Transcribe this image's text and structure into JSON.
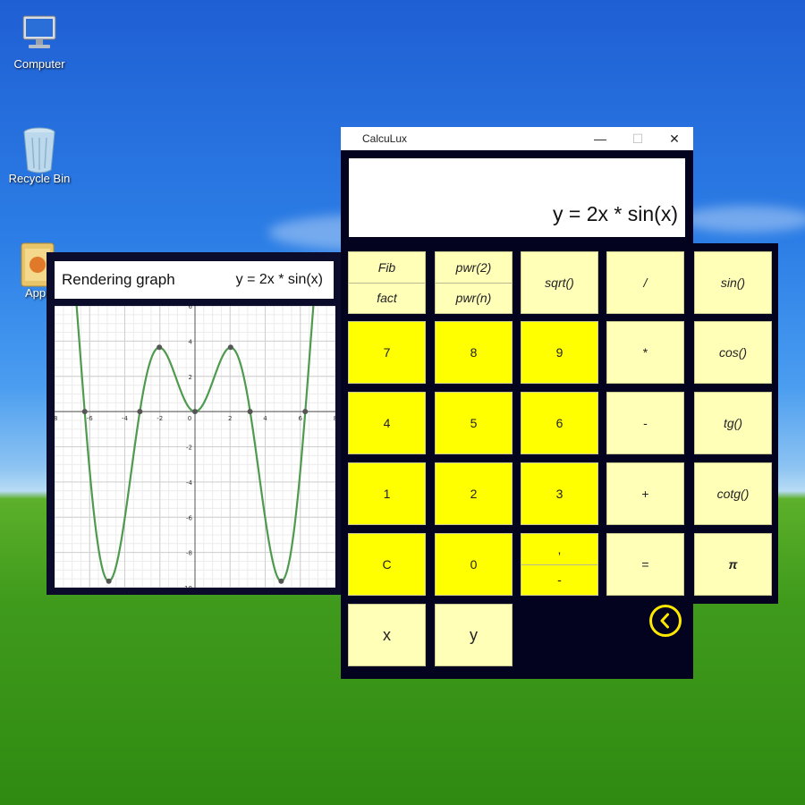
{
  "desktop": {
    "icons": [
      {
        "label": "Computer",
        "icon": "computer-icon"
      },
      {
        "label": "Recycle Bin",
        "icon": "recycle-bin-icon"
      },
      {
        "label": "App",
        "icon": "folder-icon"
      }
    ]
  },
  "graph_panel": {
    "status": "Rendering graph",
    "function_label": "y = 2x * sin(x)"
  },
  "calculator": {
    "title": "CalcuLux",
    "window_controls": {
      "minimize": "—",
      "maximize": "☐",
      "close": "✕"
    },
    "display": "y = 2x * sin(x)",
    "keys": {
      "fib": "Fib",
      "fact": "fact",
      "pwr2": "pwr(2)",
      "pwrn": "pwr(n)",
      "sqrt": "sqrt()",
      "divide": "/",
      "sin": "sin()",
      "k7": "7",
      "k8": "8",
      "k9": "9",
      "multiply": "*",
      "cos": "cos()",
      "k4": "4",
      "k5": "5",
      "k6": "6",
      "minus": "-",
      "tg": "tg()",
      "k1": "1",
      "k2": "2",
      "k3": "3",
      "plus": "+",
      "cotg": "cotg()",
      "clear": "C",
      "k0": "0",
      "comma": ",",
      "negate": "-",
      "equals": "=",
      "pi": "π",
      "x": "x",
      "y": "y"
    },
    "back_icon": "chevron-left-icon",
    "colors": {
      "light_key": "#ffffb8",
      "bright_key": "#ffff00",
      "panel": "#03031f",
      "accent": "#ffe800"
    }
  },
  "chart_data": {
    "type": "line",
    "function": "y = 2x * sin(x)",
    "xlim": [
      -8,
      8
    ],
    "ylim": [
      -10,
      6
    ],
    "x_ticks": [
      -8,
      -6,
      -4,
      -2,
      0,
      2,
      4,
      6,
      8
    ],
    "y_ticks": [
      -10,
      -8,
      -6,
      -4,
      -2,
      0,
      2,
      4,
      6
    ],
    "x_tick_labels": [
      "-8",
      "-6",
      "-4",
      "-2",
      "0",
      "2",
      "4",
      "6",
      "8"
    ],
    "y_tick_labels": [
      "-10",
      "-8",
      "-6",
      "-4",
      "-2",
      "",
      "2",
      "4",
      "6"
    ],
    "grid": true,
    "line_color": "#4e9a4e",
    "points": [
      {
        "x": -6.28,
        "y": 0
      },
      {
        "x": -4.91,
        "y": -9.63
      },
      {
        "x": -3.14,
        "y": 0
      },
      {
        "x": -2.03,
        "y": 3.65
      },
      {
        "x": 0,
        "y": 0
      },
      {
        "x": 2.03,
        "y": 3.65
      },
      {
        "x": 3.14,
        "y": 0
      },
      {
        "x": 4.91,
        "y": -9.63
      },
      {
        "x": 6.28,
        "y": 0
      }
    ]
  }
}
